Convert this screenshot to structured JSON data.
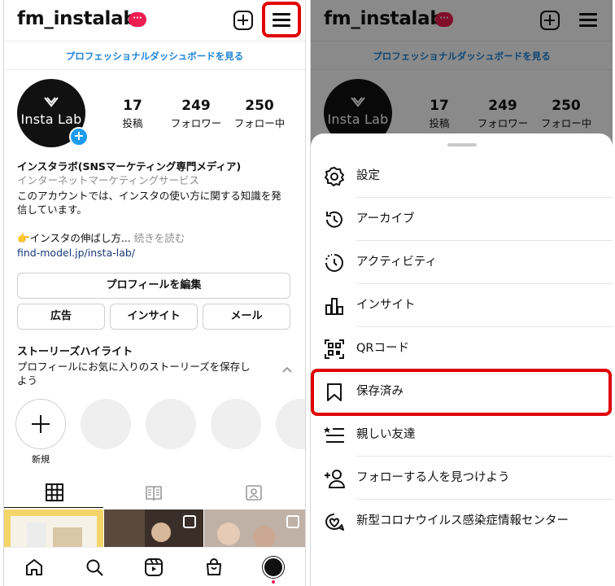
{
  "left": {
    "header": {
      "username": "fm_instalab",
      "badge": "···"
    },
    "dashboard_link": "プロフェッショナルダッシュボードを見る",
    "avatar": {
      "brand": "Insta Lab"
    },
    "stats": [
      {
        "value": "17",
        "label": "投稿"
      },
      {
        "value": "249",
        "label": "フォロワー"
      },
      {
        "value": "250",
        "label": "フォロー中"
      }
    ],
    "bio": {
      "name": "インスタラボ(SNSマーケティング専門メディア)",
      "category": "インターネットマーケティングサービス",
      "line1": "このアカウントでは、インスタの使い方に関する知識を発",
      "line2": "信しています。",
      "teaser": "👉インスタの伸ばし方...",
      "more": "続きを読む",
      "url": "find-model.jp/insta-lab/"
    },
    "buttons": {
      "edit_profile": "プロフィールを編集",
      "ad": "広告",
      "insights": "インサイト",
      "email": "メール"
    },
    "highlights": {
      "title": "ストーリーズハイライト",
      "desc_line1": "プロフィールにお気に入りのストーリーズを保存し",
      "desc_line2": "よう",
      "new_label": "新規"
    },
    "tabs": [
      "grid-icon",
      "reels-book-icon",
      "tagged-icon"
    ],
    "nav": [
      "home-icon",
      "search-icon",
      "reels-icon",
      "shop-icon",
      "profile-avatar"
    ],
    "colors": {
      "accent_link": "#1d83d8",
      "notify_red": "#ee1d52",
      "highlight_box": "#e00000"
    }
  },
  "right": {
    "header": {
      "username": "fm_instalab",
      "badge": "···"
    },
    "dashboard_link": "プロフェッショナルダッシュボードを見る",
    "avatar": {
      "brand": "Insta Lab"
    },
    "stats": [
      {
        "value": "17",
        "label": "投稿"
      },
      {
        "value": "249",
        "label": "フォロワー"
      },
      {
        "value": "250",
        "label": "フォロー中"
      }
    ],
    "menu": [
      {
        "label": "設定",
        "icon": "settings-gear-icon"
      },
      {
        "label": "アーカイブ",
        "icon": "archive-history-icon"
      },
      {
        "label": "アクティビティ",
        "icon": "activity-clock-icon"
      },
      {
        "label": "インサイト",
        "icon": "insights-bar-chart-icon"
      },
      {
        "label": "QRコード",
        "icon": "qr-code-icon"
      },
      {
        "label": "保存済み",
        "icon": "bookmark-icon"
      },
      {
        "label": "親しい友達",
        "icon": "close-friends-list-icon"
      },
      {
        "label": "フォローする人を見つけよう",
        "icon": "add-person-icon"
      },
      {
        "label": "新型コロナウイルス感染症情報センター",
        "icon": "covid-info-icon"
      }
    ]
  }
}
